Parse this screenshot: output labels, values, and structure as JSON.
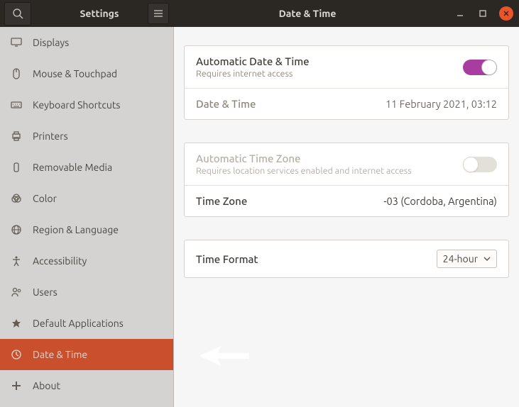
{
  "header": {
    "left_title": "Settings",
    "panel_title": "Date & Time"
  },
  "sidebar": {
    "items": [
      {
        "icon": "monitor-icon",
        "label": "Displays"
      },
      {
        "icon": "mouse-icon",
        "label": "Mouse & Touchpad"
      },
      {
        "icon": "keyboard-icon",
        "label": "Keyboard Shortcuts"
      },
      {
        "icon": "printer-icon",
        "label": "Printers"
      },
      {
        "icon": "usb-icon",
        "label": "Removable Media"
      },
      {
        "icon": "color-icon",
        "label": "Color"
      },
      {
        "icon": "globe-icon",
        "label": "Region & Language"
      },
      {
        "icon": "accessibility-icon",
        "label": "Accessibility"
      },
      {
        "icon": "users-icon",
        "label": "Users"
      },
      {
        "icon": "star-icon",
        "label": "Default Applications"
      },
      {
        "icon": "clock-icon",
        "label": "Date & Time",
        "active": true
      },
      {
        "icon": "plus-icon",
        "label": "About"
      }
    ]
  },
  "groups": {
    "auto_dt": {
      "title": "Automatic Date & Time",
      "sub": "Requires internet access",
      "enabled": true
    },
    "dt_row": {
      "title": "Date & Time",
      "value": "11 February 2021, 03:12"
    },
    "auto_tz": {
      "title": "Automatic Time Zone",
      "sub": "Requires location services enabled and internet access",
      "enabled": false,
      "available": false
    },
    "tz_row": {
      "title": "Time Zone",
      "value": "-03 (Cordoba, Argentina)"
    },
    "tf_row": {
      "title": "Time Format",
      "value": "24-hour"
    }
  },
  "colors": {
    "accent": "#e9552b",
    "toggle_on": "#a93ca0"
  }
}
